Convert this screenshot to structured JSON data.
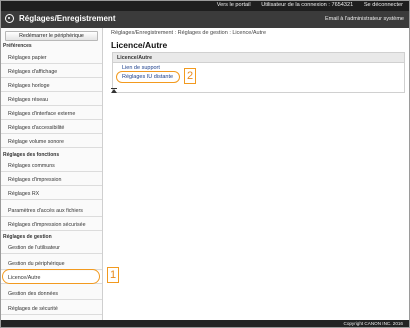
{
  "top_bar": {
    "portal_link": "Vers le portail",
    "user_label": "Utilisateur de la connexion : 7654321",
    "logout_link": "Se déconnecter"
  },
  "header": {
    "logo_icon": "canon-settings-icon",
    "title": "Réglages/Enregistrement",
    "email_link": "Email à l'administrateur système"
  },
  "sidebar": {
    "restart_button": "Redémarrer le périphérique",
    "sections": {
      "preferences": "Préférences",
      "functions": "Réglages des fonctions",
      "management": "Réglages de gestion"
    },
    "preferences_items": [
      "Réglages papier",
      "Réglages d'affichage",
      "Réglages horloge",
      "Réglages réseau",
      "Réglages d'interface externe",
      "Réglages d'accessibilité",
      "Réglage volume sonore"
    ],
    "function_items": [
      "Réglages communs",
      "Réglages d'impression",
      "Réglages RX",
      "Paramètres d'accès aux fichiers",
      "Réglages d'impression sécurisée"
    ],
    "management_items": [
      "Gestion de l'utilisateur",
      "Gestion du périphérique",
      "Licence/Autre",
      "Gestion des données",
      "Réglages de sécurité"
    ]
  },
  "main": {
    "breadcrumb": "Réglages/Enregistrement : Réglages de gestion : Licence/Autre",
    "title": "Licence/Autre",
    "panel_title": "Licence/Autre",
    "links": [
      "Lien de support",
      "Réglages IU distante"
    ],
    "top_icon": "arrow-to-top-icon"
  },
  "callouts": {
    "one": "1",
    "two": "2",
    "color": "#f29a1f"
  },
  "footer": {
    "copyright": "Copyright CANON INC. 2016"
  }
}
